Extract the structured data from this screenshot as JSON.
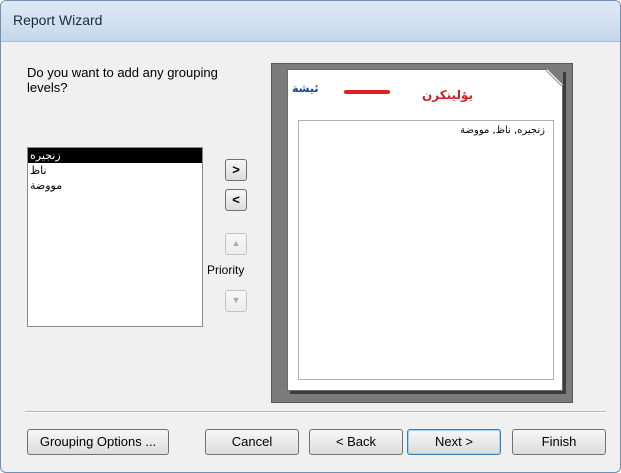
{
  "window": {
    "title": "Report Wizard"
  },
  "prompt": "Do you want to add any grouping levels?",
  "fields": [
    {
      "label": "زنجيره",
      "selected": true
    },
    {
      "label": "ناظ",
      "selected": false
    },
    {
      "label": "مووضة",
      "selected": false
    }
  ],
  "buttons": {
    "add": ">",
    "remove": "<",
    "priority_up": "▲",
    "priority_down": "▼",
    "priority_label": "Priority",
    "grouping_options": "Grouping Options ...",
    "cancel": "Cancel",
    "back": "< Back",
    "next": "Next >",
    "finish": "Finish"
  },
  "preview": {
    "group_header": "ئيشة",
    "header_fields": "يؤلينكرن",
    "detail_fields": "زنجيره, ناظ, مووضة"
  },
  "colors": {
    "group_header_text": "#1f3f9c",
    "header_fields_text": "#d42020",
    "header_line": "#e02020"
  }
}
